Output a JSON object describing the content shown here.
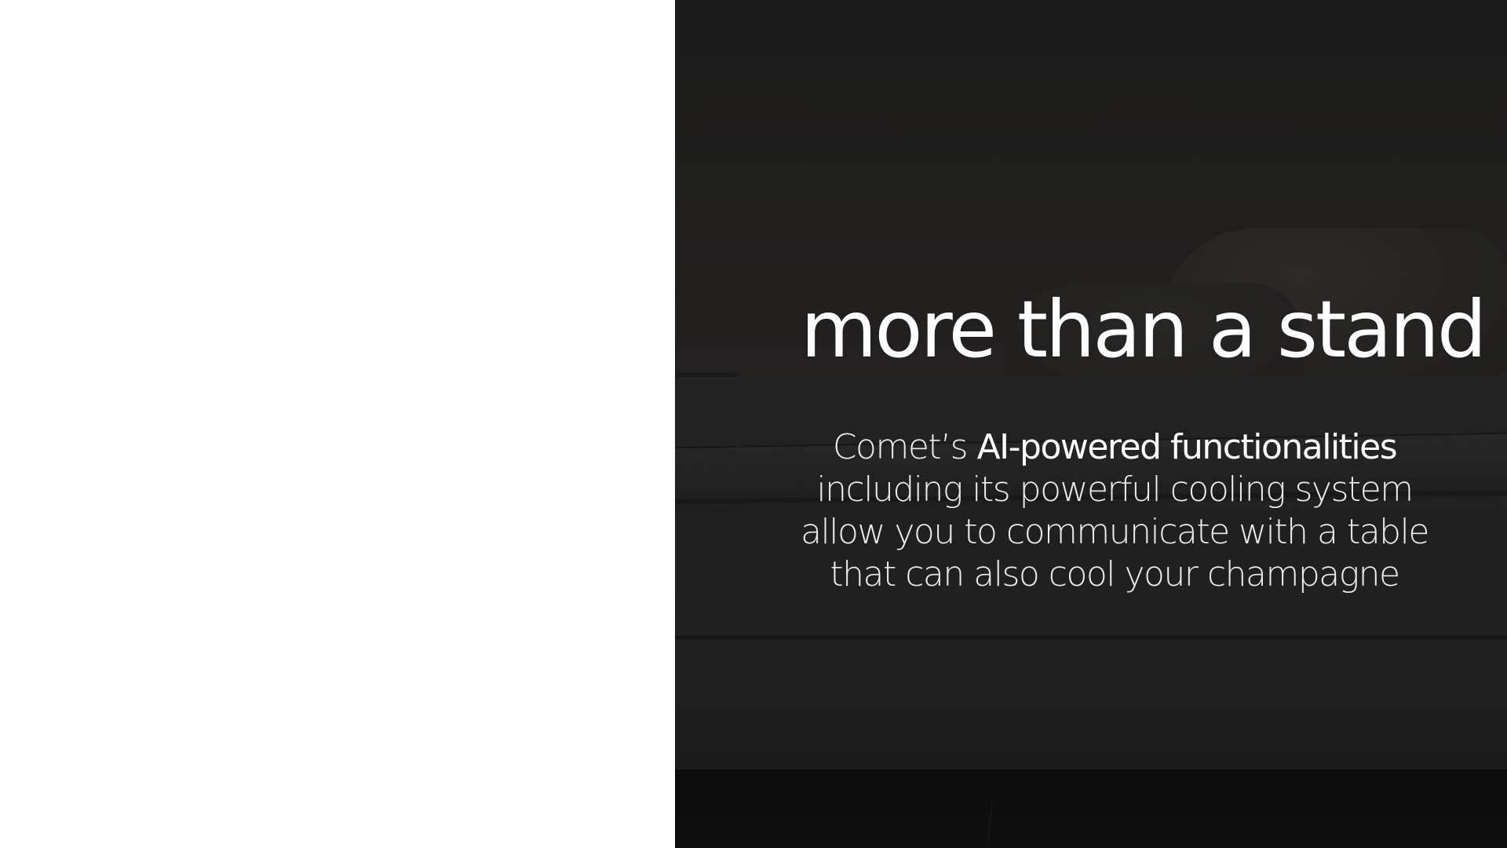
{
  "slide": {
    "headline": "more than a stand",
    "body": {
      "lead": "Comet’s ",
      "emphasis": "AI-powered functionalities",
      "line2": "including its powerful cooling system",
      "line3": "allow you to communicate with a table",
      "line4": "that can also cool your champagne"
    }
  },
  "colors": {
    "left_panel": "#ffffff",
    "right_panel": "#1d1d1d",
    "text": "#ffffff"
  }
}
